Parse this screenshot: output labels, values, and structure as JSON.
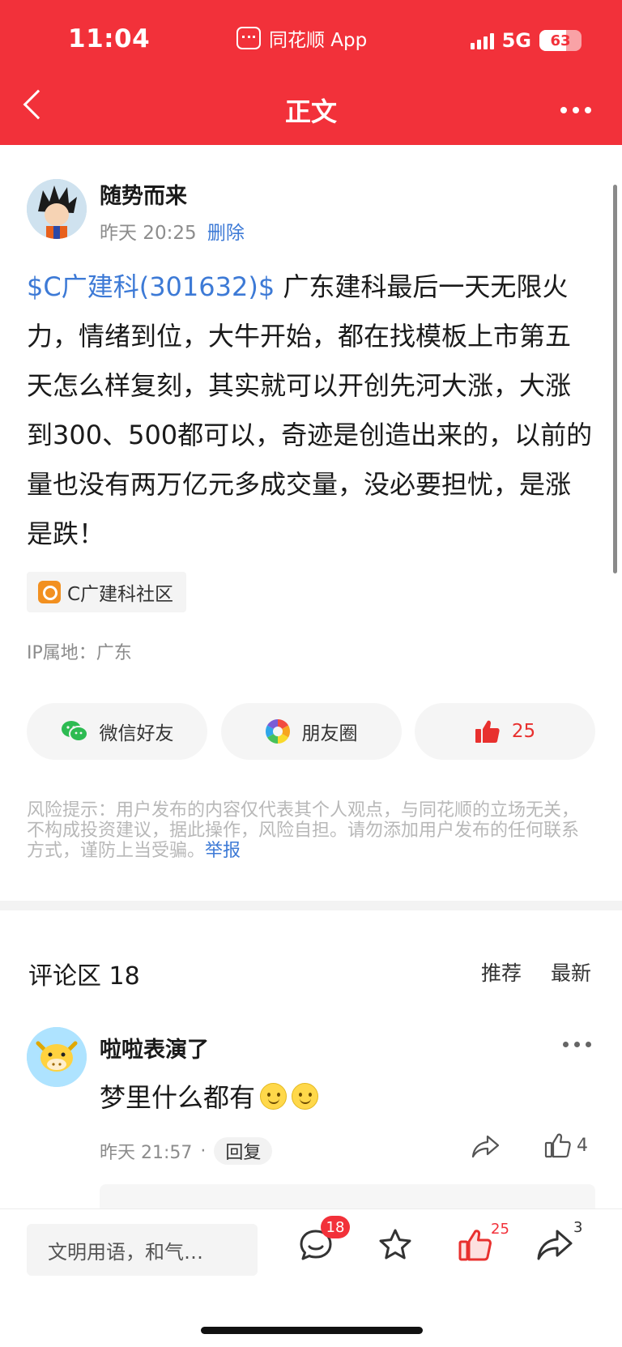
{
  "status_bar": {
    "time": "11:04",
    "app_name": "同花顺 App",
    "network": "5G",
    "battery": "63",
    "battery_fill": 0.63
  },
  "nav": {
    "title": "正文",
    "back_icon": "chevron-left-icon",
    "more_icon": "more-icon"
  },
  "post": {
    "author": "随势而来",
    "time": "昨天 20:25",
    "delete_label": "删除",
    "stock_link": "$C广建科(301632)$",
    "content": " 广东建科最后一天无限火力，情绪到位，大牛开始，都在找模板上市第五天怎么样复刻，其实就可以开创先河大涨，大涨到300、500都可以，奇迹是创造出来的，以前的量也没有两万亿元多成交量，没必要担忧，是涨是跌！",
    "community_tag": "C广建科社区",
    "ip_location": "IP属地：广东"
  },
  "share": {
    "wechat_label": "微信好友",
    "moments_label": "朋友圈",
    "like_count": "25"
  },
  "risk_notice": {
    "text": "风险提示：用户发布的内容仅代表其个人观点，与同花顺的立场无关，不构成投资建议，据此操作，风险自担。请勿添加用户发布的任何联系方式，谨防上当受骗。",
    "report_label": "举报"
  },
  "comments": {
    "title": "评论区 18",
    "sort_recommend": "推荐",
    "sort_latest": "最新",
    "items": [
      {
        "user": "啦啦表演了",
        "text": "梦里什么都有",
        "time": "昨天 21:57",
        "reply_label": "回复",
        "like_count": "4"
      }
    ]
  },
  "bottom_bar": {
    "input_placeholder": "文明用语，和气…",
    "comment_count": "18",
    "like_count": "25",
    "share_count": "3"
  },
  "colors": {
    "brand_red": "#f2313a",
    "link_blue": "#3d7ad6"
  }
}
